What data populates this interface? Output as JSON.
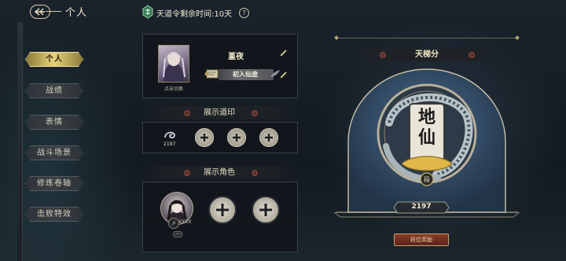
{
  "header": {
    "title": "个人",
    "timer_label": "天道令剩余时间:10天",
    "help_symbol": "?"
  },
  "sidebar": {
    "items": [
      {
        "label": "个人",
        "active": true
      },
      {
        "label": "战绩",
        "active": false
      },
      {
        "label": "表情",
        "active": false
      },
      {
        "label": "战斗场景",
        "active": false
      },
      {
        "label": "修炼卷轴",
        "active": false
      },
      {
        "label": "击败特效",
        "active": false
      }
    ]
  },
  "profile": {
    "avatar_caption": "点击切换",
    "name": "堇夜",
    "title": "初入仙途"
  },
  "seals": {
    "heading": "展示道印",
    "first_value": "2197"
  },
  "characters": {
    "heading": "展示角色",
    "first_badge": "㐅",
    "first_id": "XXXX",
    "minus_symbol": "—"
  },
  "ladder": {
    "heading": "天梯分",
    "rank_char_1": "地",
    "rank_char_2": "仙",
    "tier_label": "段",
    "score": "2197",
    "reward_button": "段位奖励"
  },
  "colors": {
    "accent_gold": "#e8d27a",
    "panel_bg": "#12161b",
    "medal_blue": "#3e5a78"
  }
}
